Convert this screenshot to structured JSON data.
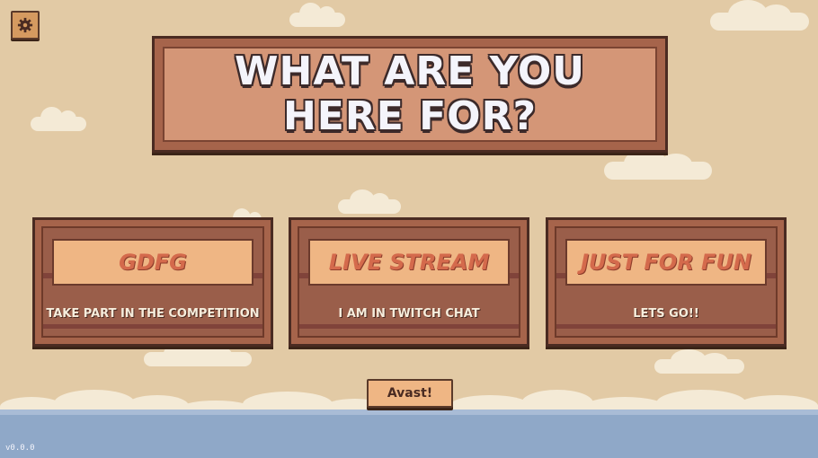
{
  "title": "WHAT ARE YOU HERE FOR?",
  "settings_icon": "gear-icon",
  "cards": [
    {
      "label": "GDFG",
      "description": "TAKE PART IN THE COMPETITION"
    },
    {
      "label": "LIVE STREAM",
      "description": "I AM IN TWITCH CHAT"
    },
    {
      "label": "JUST FOR FUN",
      "description": "LETS GO!!"
    }
  ],
  "confirm_button": "Avast!",
  "version": "v0.0.0",
  "colors": {
    "background": "#e2caa5",
    "cloud": "#f4ead6",
    "sea": "#8fa8c8",
    "board_frame": "#a6644b",
    "board_face": "#d49677",
    "sign": "#efb684",
    "label": "#d46a4c"
  }
}
